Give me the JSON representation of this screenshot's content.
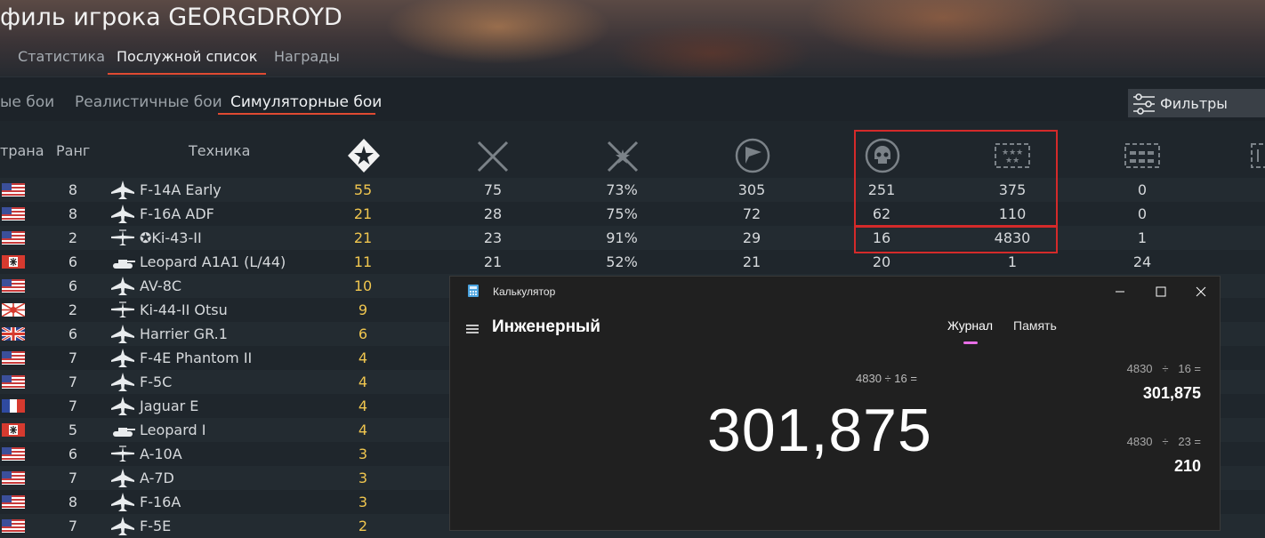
{
  "header": {
    "title": "филь игрока GEORGDROYD",
    "tabs": [
      "Статистика",
      "Послужной список",
      "Награды"
    ]
  },
  "subtabs": [
    "ые бои",
    "Реалистичные бои",
    "Симуляторные бои"
  ],
  "filters_label": "Фильтры",
  "table": {
    "headers": {
      "country": "трана",
      "rank": "Ранг",
      "vehicle": "Техника"
    },
    "rows": [
      {
        "flag": "usa",
        "rank": "8",
        "type": "jet",
        "name": "F-14A Early",
        "kills": "55",
        "c1": "75",
        "c2": "73%",
        "c3": "305",
        "c4": "251",
        "c5": "375",
        "c6": "0"
      },
      {
        "flag": "usa",
        "rank": "8",
        "type": "jet",
        "name": "F-16A ADF",
        "kills": "21",
        "c1": "28",
        "c2": "75%",
        "c3": "72",
        "c4": "62",
        "c5": "110",
        "c6": "0"
      },
      {
        "flag": "usa",
        "rank": "2",
        "type": "prop",
        "name": "✪Ki-43-II",
        "kills": "21",
        "c1": "23",
        "c2": "91%",
        "c3": "29",
        "c4": "16",
        "c5": "4830",
        "c6": "1"
      },
      {
        "flag": "germany",
        "rank": "6",
        "type": "tank",
        "name": "Leopard A1A1 (L/44)",
        "kills": "11",
        "c1": "21",
        "c2": "52%",
        "c3": "21",
        "c4": "20",
        "c5": "1",
        "c6": "24"
      },
      {
        "flag": "usa",
        "rank": "6",
        "type": "jet",
        "name": "AV-8C",
        "kills": "10"
      },
      {
        "flag": "japan",
        "rank": "2",
        "type": "prop",
        "name": "Ki-44-II Otsu",
        "kills": "9"
      },
      {
        "flag": "uk",
        "rank": "6",
        "type": "jet",
        "name": "Harrier GR.1",
        "kills": "6"
      },
      {
        "flag": "usa",
        "rank": "7",
        "type": "jet",
        "name": "F-4E Phantom II",
        "kills": "4"
      },
      {
        "flag": "usa",
        "rank": "7",
        "type": "jet",
        "name": "F-5C",
        "kills": "4"
      },
      {
        "flag": "france",
        "rank": "7",
        "type": "jet",
        "name": "Jaguar E",
        "kills": "4"
      },
      {
        "flag": "germany",
        "rank": "5",
        "type": "tank",
        "name": "Leopard I",
        "kills": "4"
      },
      {
        "flag": "usa",
        "rank": "6",
        "type": "prop",
        "name": "A-10A",
        "kills": "3"
      },
      {
        "flag": "usa",
        "rank": "7",
        "type": "jet",
        "name": "A-7D",
        "kills": "3"
      },
      {
        "flag": "usa",
        "rank": "8",
        "type": "jet",
        "name": "F-16A",
        "kills": "3"
      },
      {
        "flag": "usa",
        "rank": "7",
        "type": "jet",
        "name": "F-5E",
        "kills": "2"
      }
    ]
  },
  "calculator": {
    "title": "Калькулятор",
    "mode": "Инженерный",
    "tab_journal": "Журнал",
    "tab_memory": "Память",
    "expression": "4830 ÷ 16 =",
    "result": "301,875",
    "history": [
      {
        "expr": "4830   ÷   16 =",
        "result": "301,875"
      },
      {
        "expr": "4830   ÷   23 =",
        "result": "210"
      }
    ]
  }
}
